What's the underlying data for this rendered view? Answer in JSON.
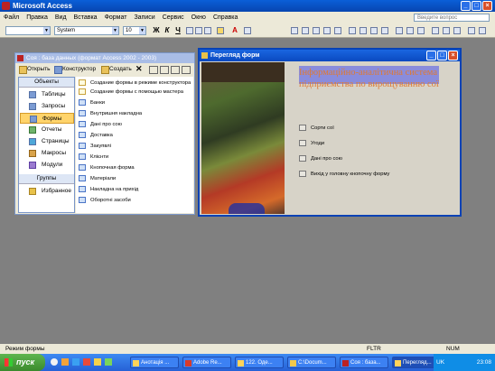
{
  "app": {
    "title": "Microsoft Access"
  },
  "menu": [
    "Файл",
    "Правка",
    "Вид",
    "Вставка",
    "Формат",
    "Записи",
    "Сервис",
    "Окно",
    "Справка"
  ],
  "help_box": {
    "placeholder": "Введите вопрос"
  },
  "toolbar": {
    "font_name": "System",
    "font_size": "10",
    "bold": "Ж",
    "italic": "К",
    "underline": "Ч",
    "font_color_label": "A"
  },
  "db_window": {
    "title": "Соя : база данных (формат Access 2002 - 2003)",
    "open_label": "Открыть",
    "designer_label": "Конструктор",
    "create_label": "Создать",
    "objects_header": "Объекты",
    "objects": [
      "Таблицы",
      "Запросы",
      "Формы",
      "Отчеты",
      "Страницы",
      "Макросы",
      "Модули"
    ],
    "selected_object": "Формы",
    "groups_header": "Группы",
    "favorites_label": "Избранное",
    "forms": [
      "Создание формы в режиме конструктора",
      "Создание формы с помощью мастера",
      "Банки",
      "Внутришня накладна",
      "Дані про сою",
      "Доставка",
      "Закупвлі",
      "Клієнти",
      "Кнопочная форма",
      "Матеріали",
      "Накладна на прихід",
      "Оборотні засоби"
    ]
  },
  "form_window": {
    "title": "Перегляд форм",
    "heading": "Інформаційно-аналітична система підприємства по вирощуванню сої",
    "buttons": [
      "Сорти сої",
      "Угоди",
      "Дані про сою",
      "Вихід у головну кнопочну форму"
    ]
  },
  "status": {
    "left": "Режим формы",
    "mid": "FLTR",
    "right": "NUM"
  },
  "taskbar": {
    "start_label": "пуск",
    "tasks": [
      "Анотація ...",
      "Adobe Re...",
      "122. Оде...",
      "C:\\Docum...",
      "Соя : база...",
      "Перегляд..."
    ],
    "active_task": "Перегляд...",
    "language": "UK",
    "clock": "23:08"
  },
  "colors": {
    "heading_text": "#e07a32",
    "heading_band": "#8a8cdb",
    "title_bar": "#0a49c0"
  }
}
